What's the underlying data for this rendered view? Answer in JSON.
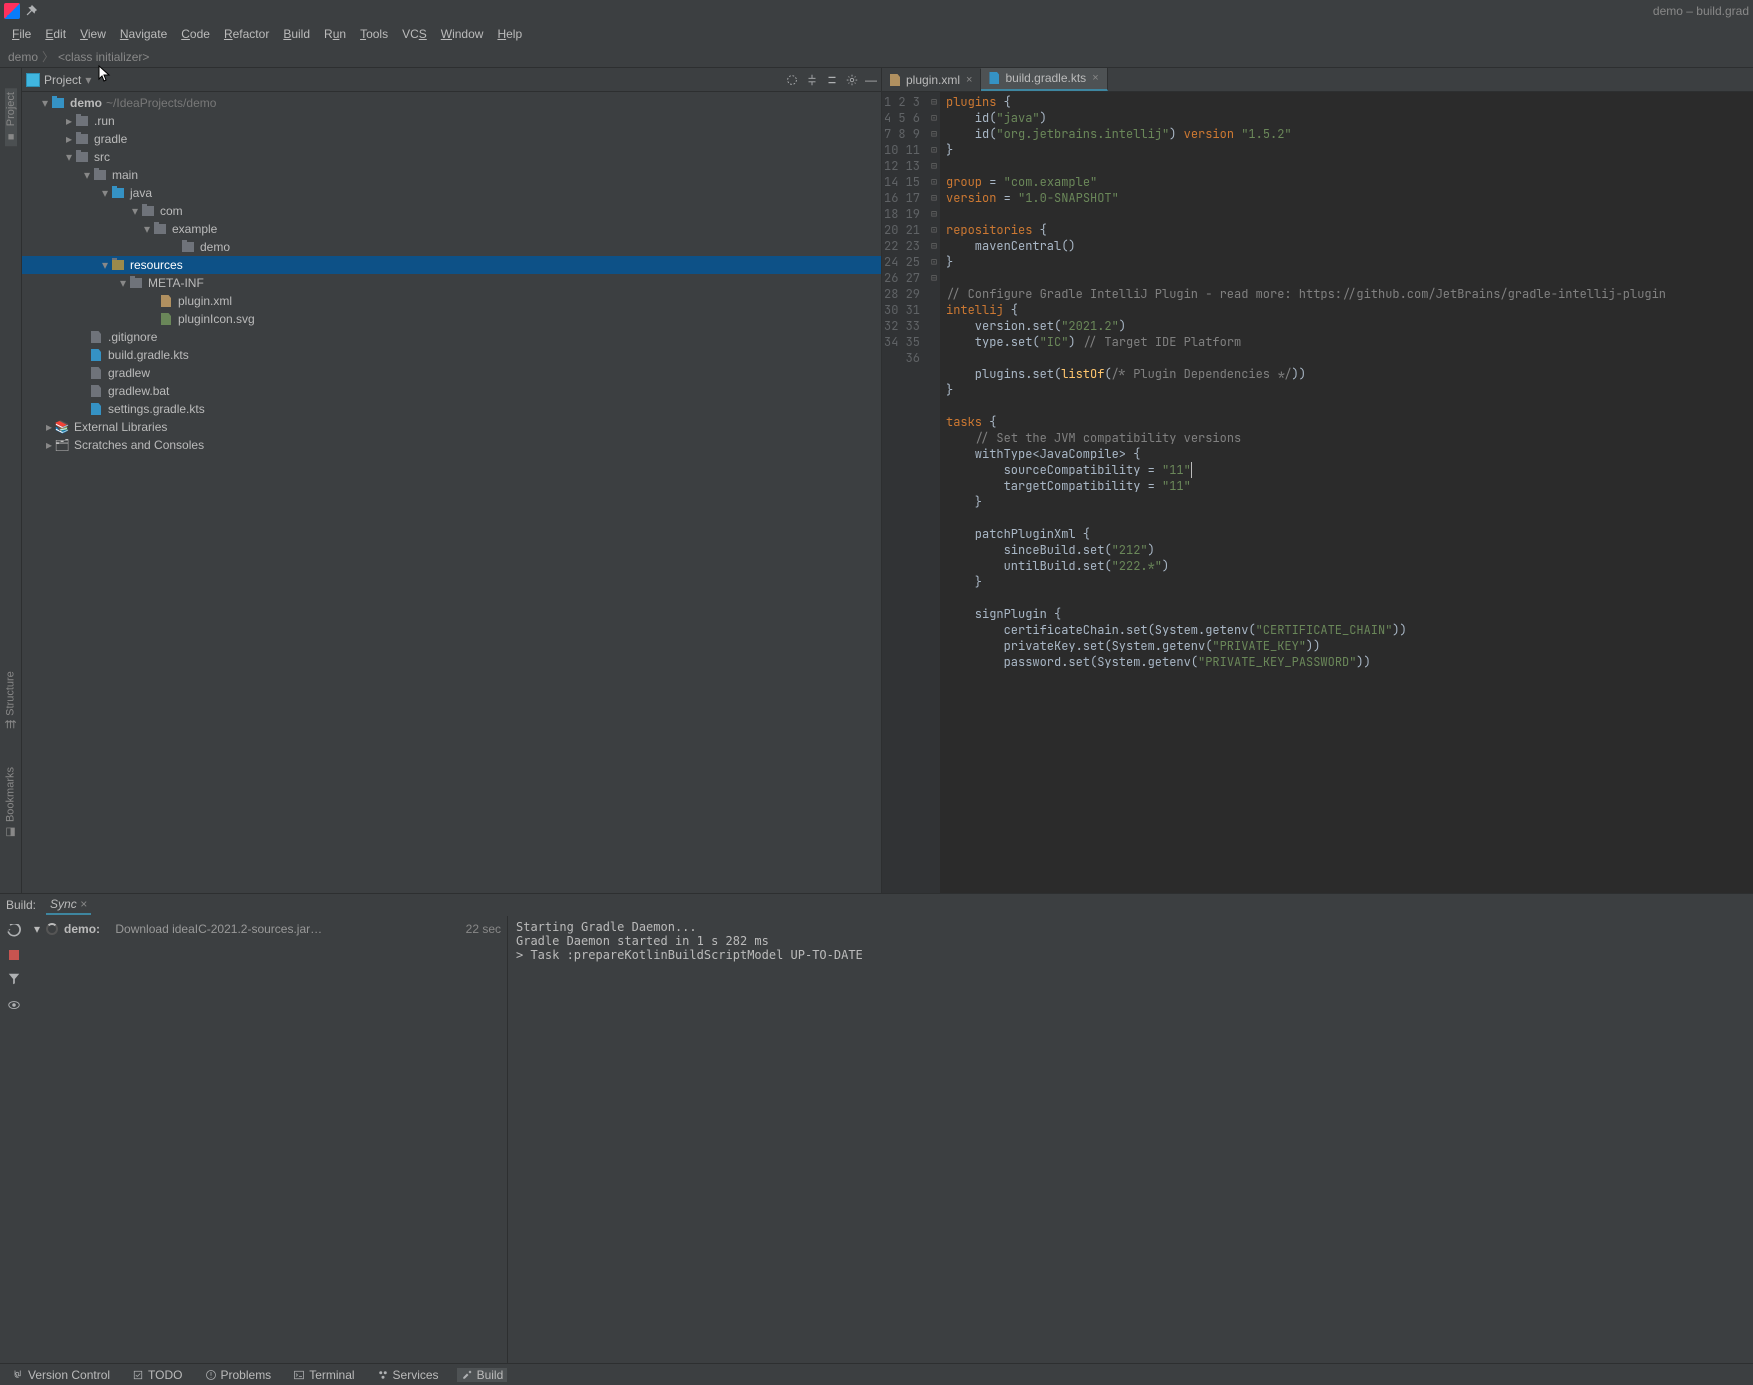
{
  "title_right": "demo – build.grad",
  "menu": [
    "File",
    "Edit",
    "View",
    "Navigate",
    "Code",
    "Refactor",
    "Build",
    "Run",
    "Tools",
    "VCS",
    "Window",
    "Help"
  ],
  "breadcrumb": {
    "root": "demo",
    "item": "<class initializer>"
  },
  "project_header": "Project",
  "leftgutter": [
    "Project",
    "Structure",
    "Bookmarks"
  ],
  "tree": {
    "root": {
      "name": "demo",
      "path": "~/IdeaProjects/demo"
    },
    "run": ".run",
    "gradle": "gradle",
    "src": "src",
    "main": "main",
    "java": "java",
    "com": "com",
    "example": "example",
    "demo": "demo",
    "resources": "resources",
    "metainf": "META-INF",
    "pluginxml": "plugin.xml",
    "pluginicon": "pluginIcon.svg",
    "gitignore": ".gitignore",
    "buildgradle": "build.gradle.kts",
    "gradlew": "gradlew",
    "gradlewbat": "gradlew.bat",
    "settings": "settings.gradle.kts",
    "extlib": "External Libraries",
    "scratch": "Scratches and Consoles"
  },
  "tabs": [
    {
      "name": "plugin.xml",
      "active": false
    },
    {
      "name": "build.gradle.kts",
      "active": true
    }
  ],
  "build_tabs": {
    "label": "Build:",
    "sync": "Sync"
  },
  "build_task": {
    "name": "demo:",
    "desc": "Download ideaIC-2021.2-sources.jar…",
    "time": "22 sec"
  },
  "build_output": "Starting Gradle Daemon...\nGradle Daemon started in 1 s 282 ms\n> Task :prepareKotlinBuildScriptModel UP-TO-DATE",
  "status": [
    "Version Control",
    "TODO",
    "Problems",
    "Terminal",
    "Services",
    "Build"
  ],
  "code_lines": 36
}
